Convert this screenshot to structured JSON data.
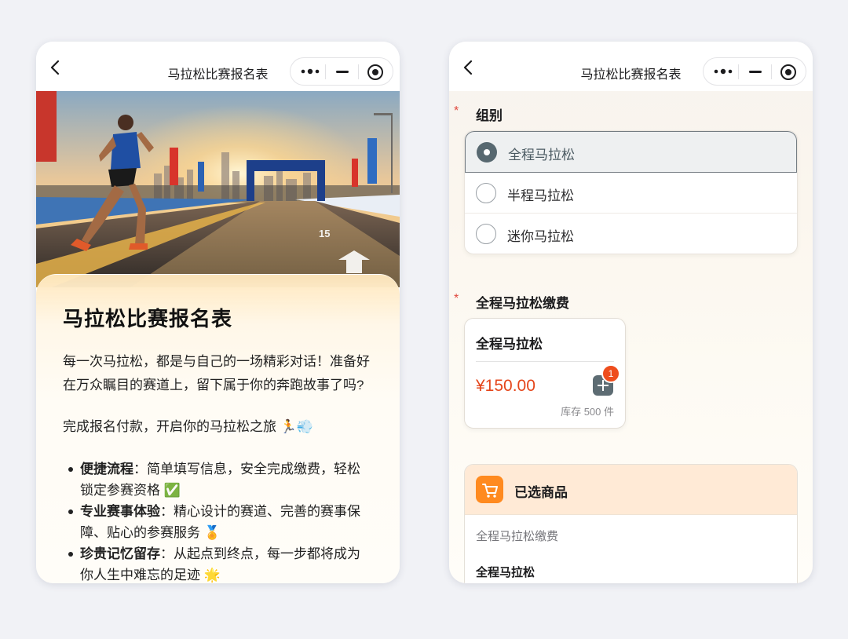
{
  "left": {
    "nav": {
      "title": "马拉松比赛报名表"
    },
    "card": {
      "title": "马拉松比赛报名表",
      "intro": "每一次马拉松，都是与自己的一场精彩对话！准备好在万众瞩目的赛道上，留下属于你的奔跑故事了吗?",
      "cta": "完成报名付款，开启你的马拉松之旅 🏃💨",
      "bullets": [
        {
          "title": "便捷流程",
          "text": "：简单填写信息，安全完成缴费，轻松锁定参赛资格 ✅"
        },
        {
          "title": "专业赛事体验",
          "text": "：精心设计的赛道、完善的赛事保障、贴心的参赛服务 🏅"
        },
        {
          "title": "珍贵记忆留存",
          "text": "：从起点到终点，每一步都将成为你人生中难忘的足迹 🌟"
        }
      ]
    },
    "hero": {
      "road_marks": [
        "15"
      ]
    }
  },
  "right": {
    "nav": {
      "title": "马拉松比赛报名表"
    },
    "group": {
      "required_mark": "*",
      "label": "组别",
      "options": [
        "全程马拉松",
        "半程马拉松",
        "迷你马拉松"
      ],
      "selected": "全程马拉松"
    },
    "fee": {
      "required_mark": "*",
      "label": "全程马拉松缴费",
      "product": {
        "name": "全程马拉松",
        "price": "¥150.00",
        "badge": "1",
        "stock": "库存 500 件"
      }
    },
    "selected_goods": {
      "title": "已选商品",
      "subtitle": "全程马拉松缴费",
      "item": "全程马拉松"
    }
  },
  "colors": {
    "accent_orange": "#ff8a1f",
    "price_red": "#e5461b",
    "badge_red": "#ee4d1d",
    "selected_radio": "#576870"
  }
}
